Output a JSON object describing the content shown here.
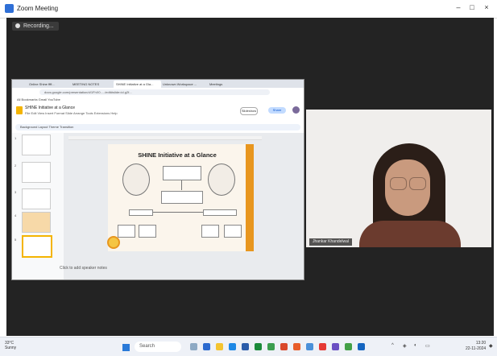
{
  "window": {
    "title": "Zoom Meeting",
    "controls": [
      "–",
      "□",
      "×"
    ]
  },
  "recording": {
    "label": "Recording..."
  },
  "browser": {
    "tabs": [
      "Online Shine ffff...",
      "MEETING NOTES",
      "SHINE Initiative at a Gla...",
      "Unknown Workspace ...",
      "Meetings"
    ],
    "url": "docs.google.com/presentation/d/1FhX0...../edit#slide=id.g2f...",
    "bookmarks": "All Bookmarks    Gmail    YouTube"
  },
  "slides_doc": {
    "title": "SHINE Initiative at a Glance",
    "menu": "File  Edit  View  Insert  Format  Slide  Arrange  Tools  Extensions  Help",
    "slideshow_label": "Slideshow",
    "share_label": "Share",
    "toolbar": "Background   Layout   Theme   Transition",
    "thumb_numbers": [
      "1",
      "2",
      "3",
      "4",
      "5"
    ],
    "speaker_notes": "Click to add speaker notes"
  },
  "slide": {
    "title": "SHINE Initiative at a Glance"
  },
  "participant": {
    "name": "Jhankar Khandelwal"
  },
  "taskbar": {
    "weather_temp": "33°C",
    "weather_desc": "Sunny",
    "search_placeholder": "Search",
    "time": "13:20",
    "date": "22-11-2024"
  },
  "colors": {
    "meeting_bg": "#232323",
    "slide_accent": "#e8961e",
    "taskbar_bg": "#eef1f7"
  }
}
